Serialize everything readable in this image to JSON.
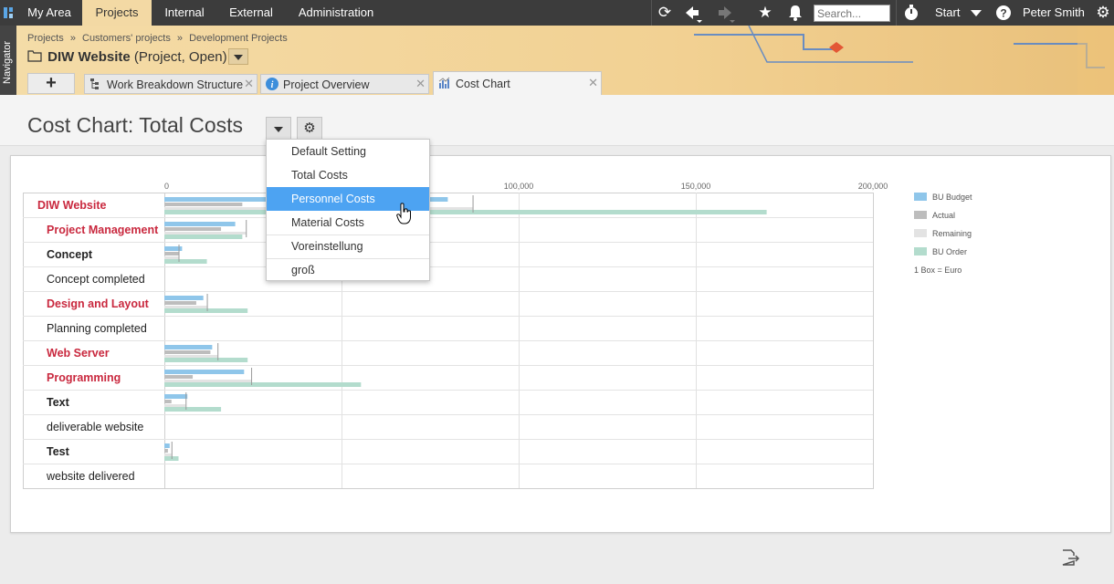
{
  "topbar": {
    "nav": [
      {
        "label": "My Area",
        "name": "nav-my-area",
        "active": false
      },
      {
        "label": "Projects",
        "name": "nav-projects",
        "active": true
      },
      {
        "label": "Internal",
        "name": "nav-internal",
        "active": false
      },
      {
        "label": "External",
        "name": "nav-external",
        "active": false
      },
      {
        "label": "Administration",
        "name": "nav-administration",
        "active": false
      }
    ],
    "search_placeholder": "Search...",
    "start_label": "Start",
    "user_name": "Peter Smith"
  },
  "navigator_label": "Navigator",
  "breadcrumb": [
    "Projects",
    "»",
    "Customers' projects",
    "»",
    "Development Projects"
  ],
  "project": {
    "name": "DIW Website",
    "status": "(Project, Open)"
  },
  "tabs": [
    {
      "label": "Work Breakdown Structure",
      "name": "tab-work-breakdown-structure",
      "icon": "wbs-icon",
      "active": false
    },
    {
      "label": "Project Overview",
      "name": "tab-project-overview",
      "icon": "info-icon",
      "active": false
    },
    {
      "label": "Cost Chart",
      "name": "tab-cost-chart",
      "icon": "chart-icon",
      "active": true
    }
  ],
  "page_title": "Cost Chart: Total Costs",
  "view_menu": {
    "items": [
      "Default Setting",
      "Total Costs",
      "Personnel Costs",
      "Material Costs",
      "Voreinstellung",
      "groß"
    ],
    "highlighted": 2
  },
  "legend": {
    "items": [
      {
        "label": "BU Budget",
        "color": "#8fc6ea"
      },
      {
        "label": "Actual",
        "color": "#bdbdbd"
      },
      {
        "label": "Remaining",
        "color": "#e3e3e3"
      },
      {
        "label": "BU Order",
        "color": "#b3dccd"
      }
    ],
    "unit_note": "1 Box = Euro"
  },
  "chart_data": {
    "type": "bar",
    "orientation": "horizontal",
    "xlim": [
      0,
      200000
    ],
    "ticks": [
      {
        "value": 0,
        "label": "0"
      },
      {
        "value": 100000,
        "label": "100,000"
      },
      {
        "value": 150000,
        "label": "150,000"
      },
      {
        "value": 200000,
        "label": "200,000"
      }
    ],
    "series": [
      {
        "name": "BU Budget",
        "color": "#8fc6ea"
      },
      {
        "name": "Actual",
        "color": "#bdbdbd"
      },
      {
        "name": "Remaining",
        "color": "#e3e3e3"
      },
      {
        "name": "BU Order",
        "color": "#b3dccd"
      }
    ],
    "rows": [
      {
        "label": "DIW Website",
        "style": "summary",
        "values": [
          80000,
          22000,
          87000,
          170000
        ],
        "marker": 87000
      },
      {
        "label": "Project Management",
        "style": "summary",
        "values": [
          20000,
          16000,
          23000,
          22000
        ],
        "marker": 23000
      },
      {
        "label": "Concept",
        "style": "task",
        "values": [
          5000,
          4000,
          4000,
          12000
        ],
        "marker": 4000
      },
      {
        "label": "Concept completed",
        "style": "milestone",
        "values": [
          0,
          0,
          0,
          0
        ],
        "marker": null
      },
      {
        "label": "Design and Layout",
        "style": "summary",
        "values": [
          11000,
          9000,
          12000,
          23500
        ],
        "marker": 12000
      },
      {
        "label": "Planning completed",
        "style": "milestone",
        "values": [
          0,
          0,
          0,
          0
        ],
        "marker": null
      },
      {
        "label": "Web Server",
        "style": "summary",
        "values": [
          13500,
          13000,
          15000,
          23500
        ],
        "marker": 15000
      },
      {
        "label": "Programming",
        "style": "summary",
        "values": [
          22500,
          8000,
          24500,
          55500
        ],
        "marker": 24500
      },
      {
        "label": "Text",
        "style": "task",
        "values": [
          6500,
          2000,
          6000,
          16000
        ],
        "marker": 6000
      },
      {
        "label": "deliverable website",
        "style": "milestone",
        "values": [
          0,
          0,
          0,
          0
        ],
        "marker": null
      },
      {
        "label": "Test",
        "style": "task",
        "values": [
          1500,
          1000,
          2000,
          4000
        ],
        "marker": 2000
      },
      {
        "label": "website delivered",
        "style": "milestone",
        "values": [
          0,
          0,
          0,
          0
        ],
        "marker": null
      }
    ]
  }
}
